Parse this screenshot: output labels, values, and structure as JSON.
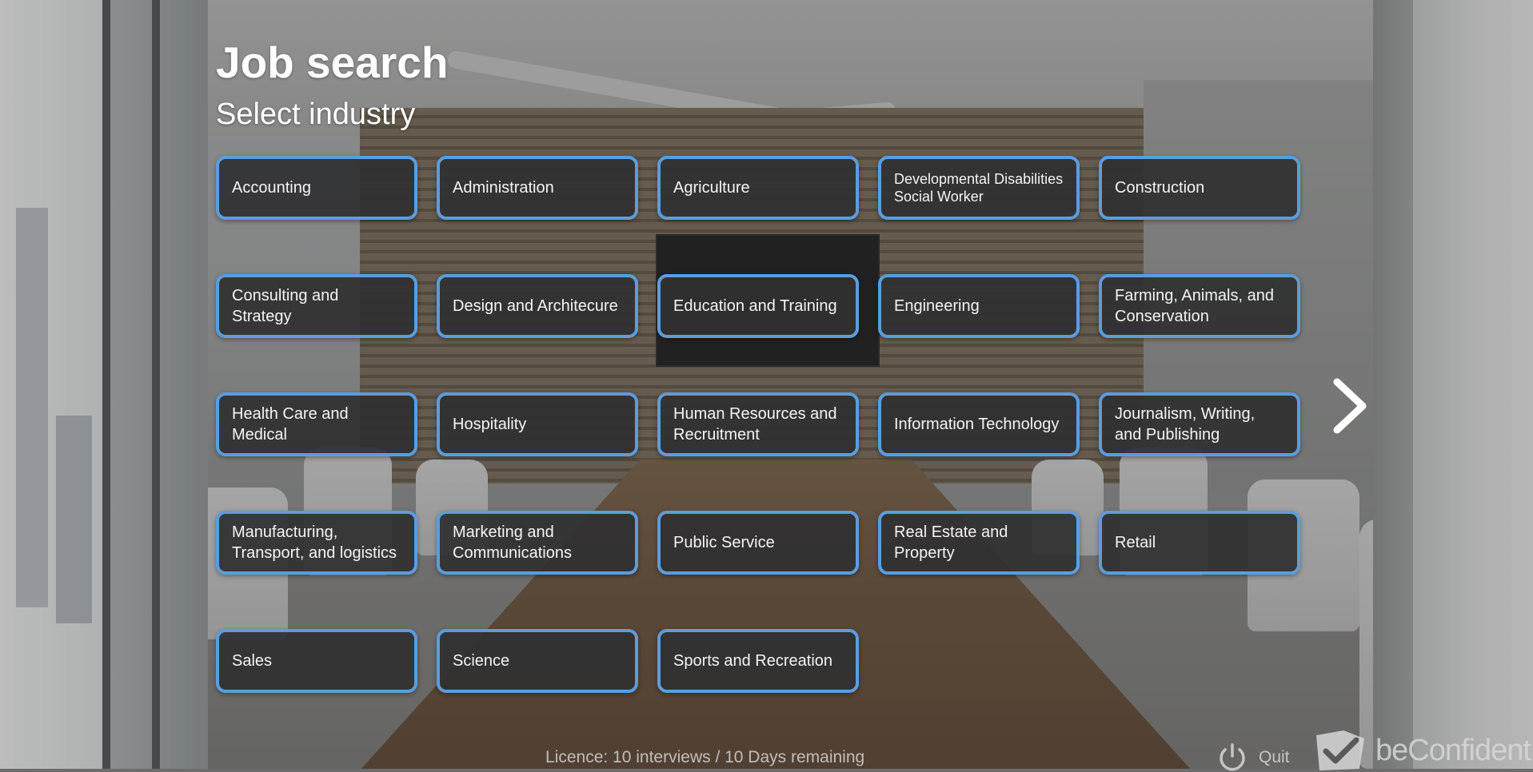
{
  "header": {
    "title": "Job search",
    "subtitle": "Select industry"
  },
  "industries": [
    "Accounting",
    "Administration",
    "Agriculture",
    "Developmental Disabilities Social Worker",
    "Construction",
    "Consulting and Strategy",
    "Design and Architecure",
    "Education and Training",
    "Engineering",
    "Farming, Animals, and Conservation",
    "Health Care and Medical",
    "Hospitality",
    "Human Resources and Recruitment",
    "Information Technology",
    "Journalism, Writing, and Publishing",
    "Manufacturing, Transport, and logistics",
    "Marketing and Communications",
    "Public Service",
    "Real Estate and Property",
    "Retail",
    "Sales",
    "Science",
    "Sports and Recreation"
  ],
  "navigation": {
    "next_icon": "chevron-right-icon"
  },
  "footer": {
    "licence": "Licence: 10 interviews / 10 Days remaining",
    "quit_label": "Quit",
    "quit_icon": "power-icon",
    "brand": "beConfident.io",
    "brand_icon": "check-logo-icon"
  },
  "colors": {
    "tile_border": "#5b9ddd",
    "tile_background": "#303032",
    "text": "#ffffff"
  }
}
